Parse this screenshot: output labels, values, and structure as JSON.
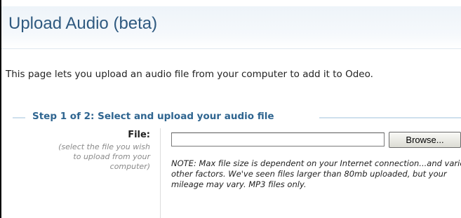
{
  "page": {
    "title": "Upload Audio (beta)",
    "intro": "This page lets you upload an audio file from your computer to add it to Odeo."
  },
  "step": {
    "heading": "Step 1 of 2: Select and upload your audio file"
  },
  "file_field": {
    "label": "File:",
    "hint": "(select the file you wish to upload from your computer)",
    "value": "",
    "browse_label": "Browse...",
    "note": "NOTE: Max file size is dependent on your Internet connection...and various other factors. We've seen files larger than 80mb uploaded, but your mileage may vary. MP3 files only."
  },
  "colors": {
    "title": "#2f5a80",
    "step_heading": "#2f6590",
    "rule": "#cfe0ed",
    "hint": "#8a8a8a"
  }
}
